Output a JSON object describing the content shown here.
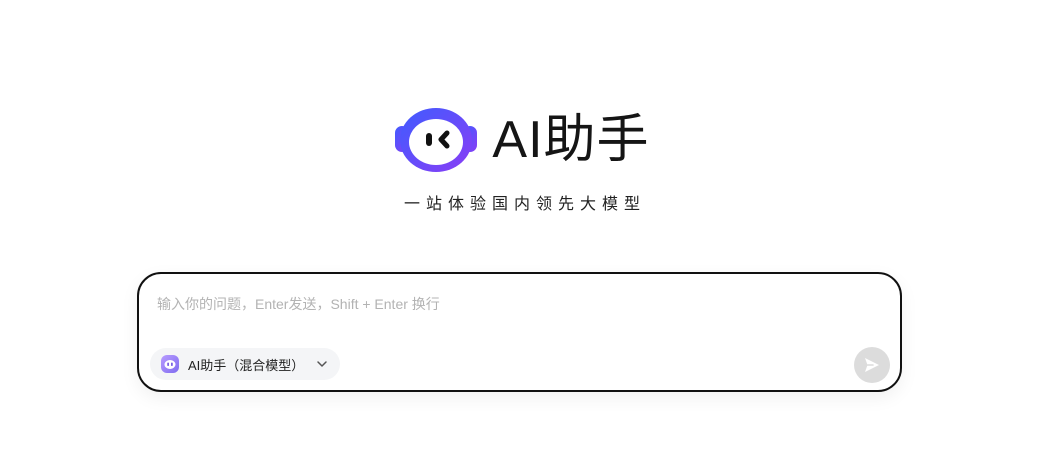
{
  "brand": {
    "title": "AI助手",
    "tagline": "一站体验国内领先大模型",
    "logo_icon": "robot-face-logo",
    "accent_colors": [
      "#3f5cff",
      "#8a3df5"
    ]
  },
  "composer": {
    "placeholder": "输入你的问题，Enter发送，Shift + Enter 换行",
    "value": "",
    "model_selector": {
      "icon": "robot-mini-icon",
      "selected": "AI助手（混合模型）",
      "dropdown_icon": "chevron-down-icon"
    },
    "send_icon": "send-icon"
  },
  "colors": {
    "border": "#111111",
    "send_disabled": "#dcdcdc",
    "selector_bg": "#f4f5f7"
  }
}
